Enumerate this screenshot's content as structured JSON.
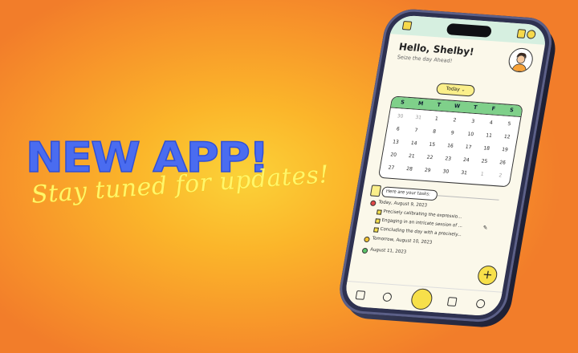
{
  "promo": {
    "headline": "NEW APP!",
    "tagline": "Stay tuned for updates!"
  },
  "app": {
    "greeting": "Hello, Shelby!",
    "subtitle": "Seize the day Ahead!",
    "today_label": "Today",
    "weekdays": [
      "S",
      "M",
      "T",
      "W",
      "T",
      "F",
      "S"
    ],
    "calendar_rows": [
      [
        "30",
        "31",
        "1",
        "2",
        "3",
        "4",
        "5"
      ],
      [
        "6",
        "7",
        "8",
        "9",
        "10",
        "11",
        "12"
      ],
      [
        "13",
        "14",
        "15",
        "16",
        "17",
        "18",
        "19"
      ],
      [
        "20",
        "21",
        "22",
        "23",
        "24",
        "25",
        "26"
      ],
      [
        "27",
        "28",
        "29",
        "30",
        "31",
        "1",
        "2"
      ]
    ],
    "selected_day": "9",
    "tasks_prompt": "Here are your tasks:",
    "task_groups": [
      {
        "date": "Today, August 9, 2023",
        "color": "#e04848"
      },
      {
        "date": "Tomorrow, August 10, 2023",
        "color": "#f2c230"
      },
      {
        "date": "August 11, 2023",
        "color": "#5cc46a"
      }
    ],
    "task_items": [
      "Precisely calibrating the expressio...",
      "Engaging in an intricate session of ...",
      "Concluding the day with a precisely..."
    ],
    "fab_label": "+"
  },
  "colors": {
    "accent_blue": "#4a6cf0",
    "tagline_yellow": "#fff56a",
    "calendar_green": "#7fd08a",
    "button_yellow": "#f7e04a"
  }
}
